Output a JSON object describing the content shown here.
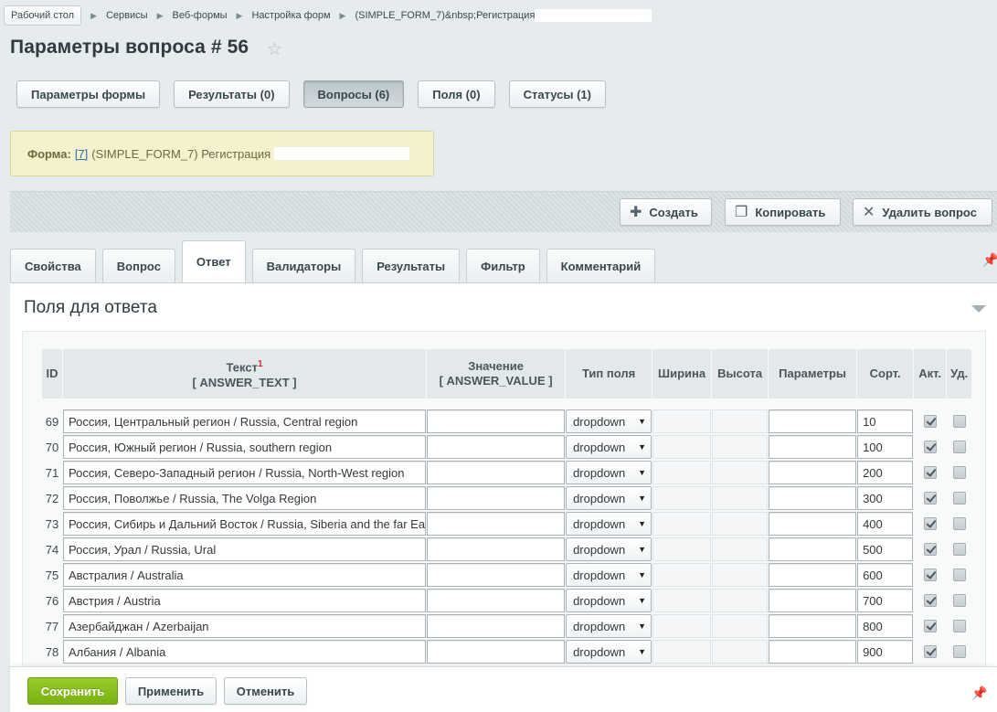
{
  "breadcrumb": {
    "items": [
      "Рабочий стол",
      "Сервисы",
      "Веб-формы",
      "Настройка форм",
      "(SIMPLE_FORM_7)&nbsp;Регистрация"
    ]
  },
  "page": {
    "title": "Параметры вопроса # 56"
  },
  "top_tabs": [
    {
      "label": "Параметры формы"
    },
    {
      "label": "Результаты (0)"
    },
    {
      "label": "Вопросы (6)"
    },
    {
      "label": "Поля (0)"
    },
    {
      "label": "Статусы (1)"
    }
  ],
  "form_info": {
    "label": "Форма:",
    "link": "[7]",
    "text": "(SIMPLE_FORM_7) Регистрация"
  },
  "toolbar": {
    "create": "Создать",
    "copy": "Копировать",
    "delete": "Удалить вопрос"
  },
  "sub_tabs": [
    {
      "label": "Свойства"
    },
    {
      "label": "Вопрос"
    },
    {
      "label": "Ответ"
    },
    {
      "label": "Валидаторы"
    },
    {
      "label": "Результаты"
    },
    {
      "label": "Фильтр"
    },
    {
      "label": "Комментарий"
    }
  ],
  "section": {
    "title": "Поля для ответа"
  },
  "table": {
    "headers": {
      "id": "ID",
      "text": "Текст",
      "text_sup": "1",
      "text_code": "[ ANSWER_TEXT ]",
      "value": "Значение",
      "value_code": "[ ANSWER_VALUE ]",
      "type": "Тип поля",
      "width": "Ширина",
      "height": "Высота",
      "params": "Параметры",
      "sort": "Сорт.",
      "active": "Акт.",
      "delete": "Уд."
    },
    "rows": [
      {
        "id": "69",
        "text": "Россия, Центральный регион / Russia, Central region",
        "value": "",
        "type": "dropdown",
        "sort": "10",
        "active": true,
        "delete": false
      },
      {
        "id": "70",
        "text": "Россия, Южный регион / Russia, southern region",
        "value": "",
        "type": "dropdown",
        "sort": "100",
        "active": true,
        "delete": false
      },
      {
        "id": "71",
        "text": "Россия, Северо-Западный регион / Russia, North-West region",
        "value": "",
        "type": "dropdown",
        "sort": "200",
        "active": true,
        "delete": false
      },
      {
        "id": "72",
        "text": "Россия, Поволжье / Russia, The Volga Region",
        "value": "",
        "type": "dropdown",
        "sort": "300",
        "active": true,
        "delete": false
      },
      {
        "id": "73",
        "text": "Россия, Сибирь и Дальний Восток / Russia, Siberia and the far Ea",
        "value": "",
        "type": "dropdown",
        "sort": "400",
        "active": true,
        "delete": false
      },
      {
        "id": "74",
        "text": "Россия, Урал / Russia, Ural",
        "value": "",
        "type": "dropdown",
        "sort": "500",
        "active": true,
        "delete": false
      },
      {
        "id": "75",
        "text": "Австралия / Australia",
        "value": "",
        "type": "dropdown",
        "sort": "600",
        "active": true,
        "delete": false
      },
      {
        "id": "76",
        "text": "Австрия / Austria",
        "value": "",
        "type": "dropdown",
        "sort": "700",
        "active": true,
        "delete": false
      },
      {
        "id": "77",
        "text": "Азербайджан / Azerbaijan",
        "value": "",
        "type": "dropdown",
        "sort": "800",
        "active": true,
        "delete": false
      },
      {
        "id": "78",
        "text": "Албания / Albania",
        "value": "",
        "type": "dropdown",
        "sort": "900",
        "active": true,
        "delete": false
      }
    ]
  },
  "footer": {
    "save": "Сохранить",
    "apply": "Применить",
    "cancel": "Отменить"
  }
}
